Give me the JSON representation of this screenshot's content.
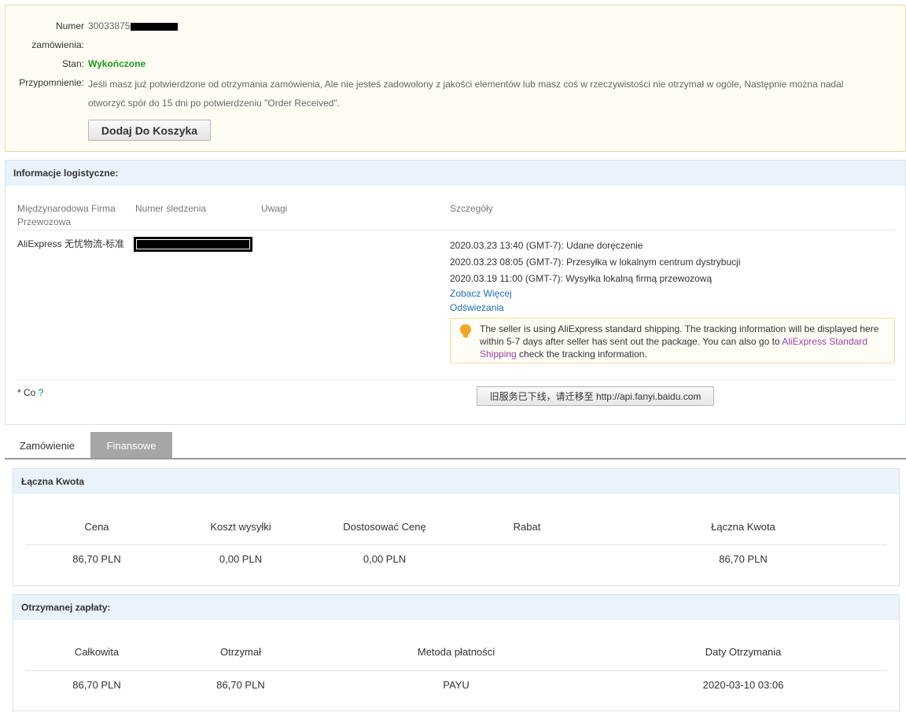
{
  "order": {
    "number_label": "Numer",
    "number_label2": "zamówienia:",
    "number_value": "30033875",
    "status_label": "Stan:",
    "status_value": "Wykończone",
    "reminder_label": "Przypomnienie:",
    "reminder_text": "Jeśli masz już potwierdzone od otrzymania zamówienia, Ale nie jesteś zadowolony z jakości elementów lub masz coś w rzeczywistości nie otrzymał w ogóle, Następnie można nadal otworzyć spór do 15 dni po potwierdzeniu \"Order Received\".",
    "add_to_cart": "Dodaj Do Koszyka"
  },
  "logistics": {
    "title": "Informacje logistyczne:",
    "headers": {
      "carrier": "Międzynarodowa Firma Przewozowa",
      "tracking": "Numer śledzenia",
      "remarks": "Uwagi",
      "details": "Szczegóły"
    },
    "carrier": "AliExpress 无忧物流-标准",
    "events": [
      "2020.03.23 13:40 (GMT-7): Udane doręczenie",
      "2020.03.23 08:05 (GMT-7): Przesyłka w lokalnym centrum dystrybucji",
      "2020.03.19 11:00 (GMT-7): Wysyłka lokalną firmą przewozową"
    ],
    "see_more": "Zobacz Więcej",
    "refresh": "Odświeżania",
    "notice_pre": "The seller is using AliExpress standard shipping. The tracking information will be displayed here within 5-7 days after seller has sent out the package. You can also go to ",
    "notice_link": "AliExpress Standard Shipping",
    "notice_post": " check the tracking information.",
    "footnote": "* Co ",
    "footnote_q": "?",
    "baidu_button": "旧服务已下线，请迁移至 http://api.fanyi.baidu.com"
  },
  "tabs": [
    "Zamówienie",
    "Finansowe"
  ],
  "total": {
    "title": "Łączna Kwota",
    "headers": [
      "Cena",
      "Koszt wysyłki",
      "Dostosować Cenę",
      "Rabat",
      "Łączna Kwota"
    ],
    "values": [
      "86,70 PLN",
      "0,00 PLN",
      "0,00 PLN",
      "",
      "86,70 PLN"
    ]
  },
  "payment": {
    "title": "Otrzymanej zapłaty:",
    "headers": [
      "Całkowita",
      "Otrzymał",
      "Metoda płatności",
      "Daty Otrzymania"
    ],
    "values": [
      "86,70 PLN",
      "86,70 PLN",
      "PAYU",
      "2020-03-10 03:06"
    ]
  }
}
